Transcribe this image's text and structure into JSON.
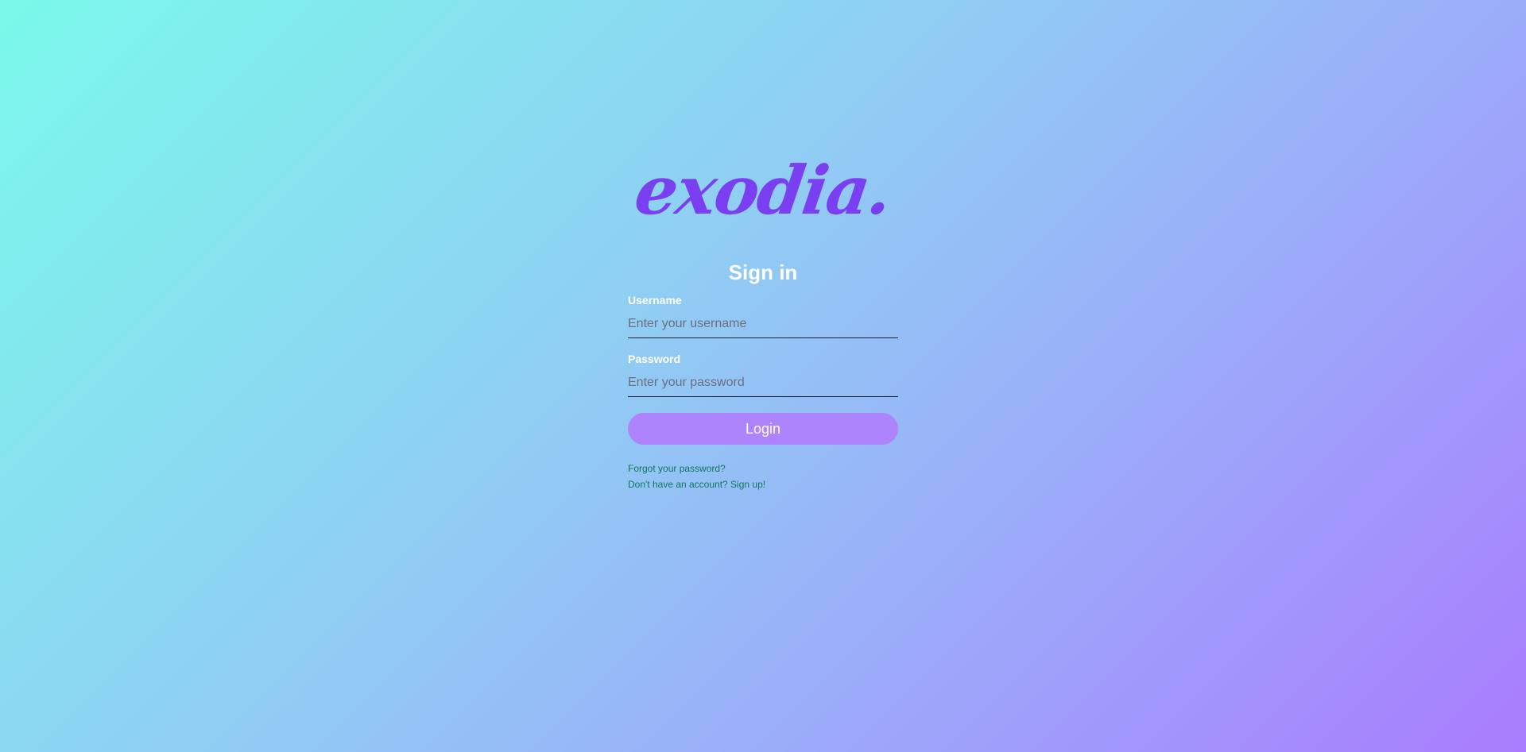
{
  "brand": {
    "logo_text": "exodia.",
    "logo_color": "#7b3ff2"
  },
  "background": {
    "gradient_start": "#7af9ea",
    "gradient_end": "#a97cfd"
  },
  "form": {
    "title": "Sign in",
    "username": {
      "label": "Username",
      "placeholder": "Enter your username",
      "value": ""
    },
    "password": {
      "label": "Password",
      "placeholder": "Enter your password",
      "value": ""
    },
    "login_label": "Login",
    "login_color": "#ad84fb"
  },
  "links": {
    "forgot_password": "Forgot your password?",
    "sign_up": "Don't have an account? Sign up!",
    "color": "#0e7a5a"
  }
}
